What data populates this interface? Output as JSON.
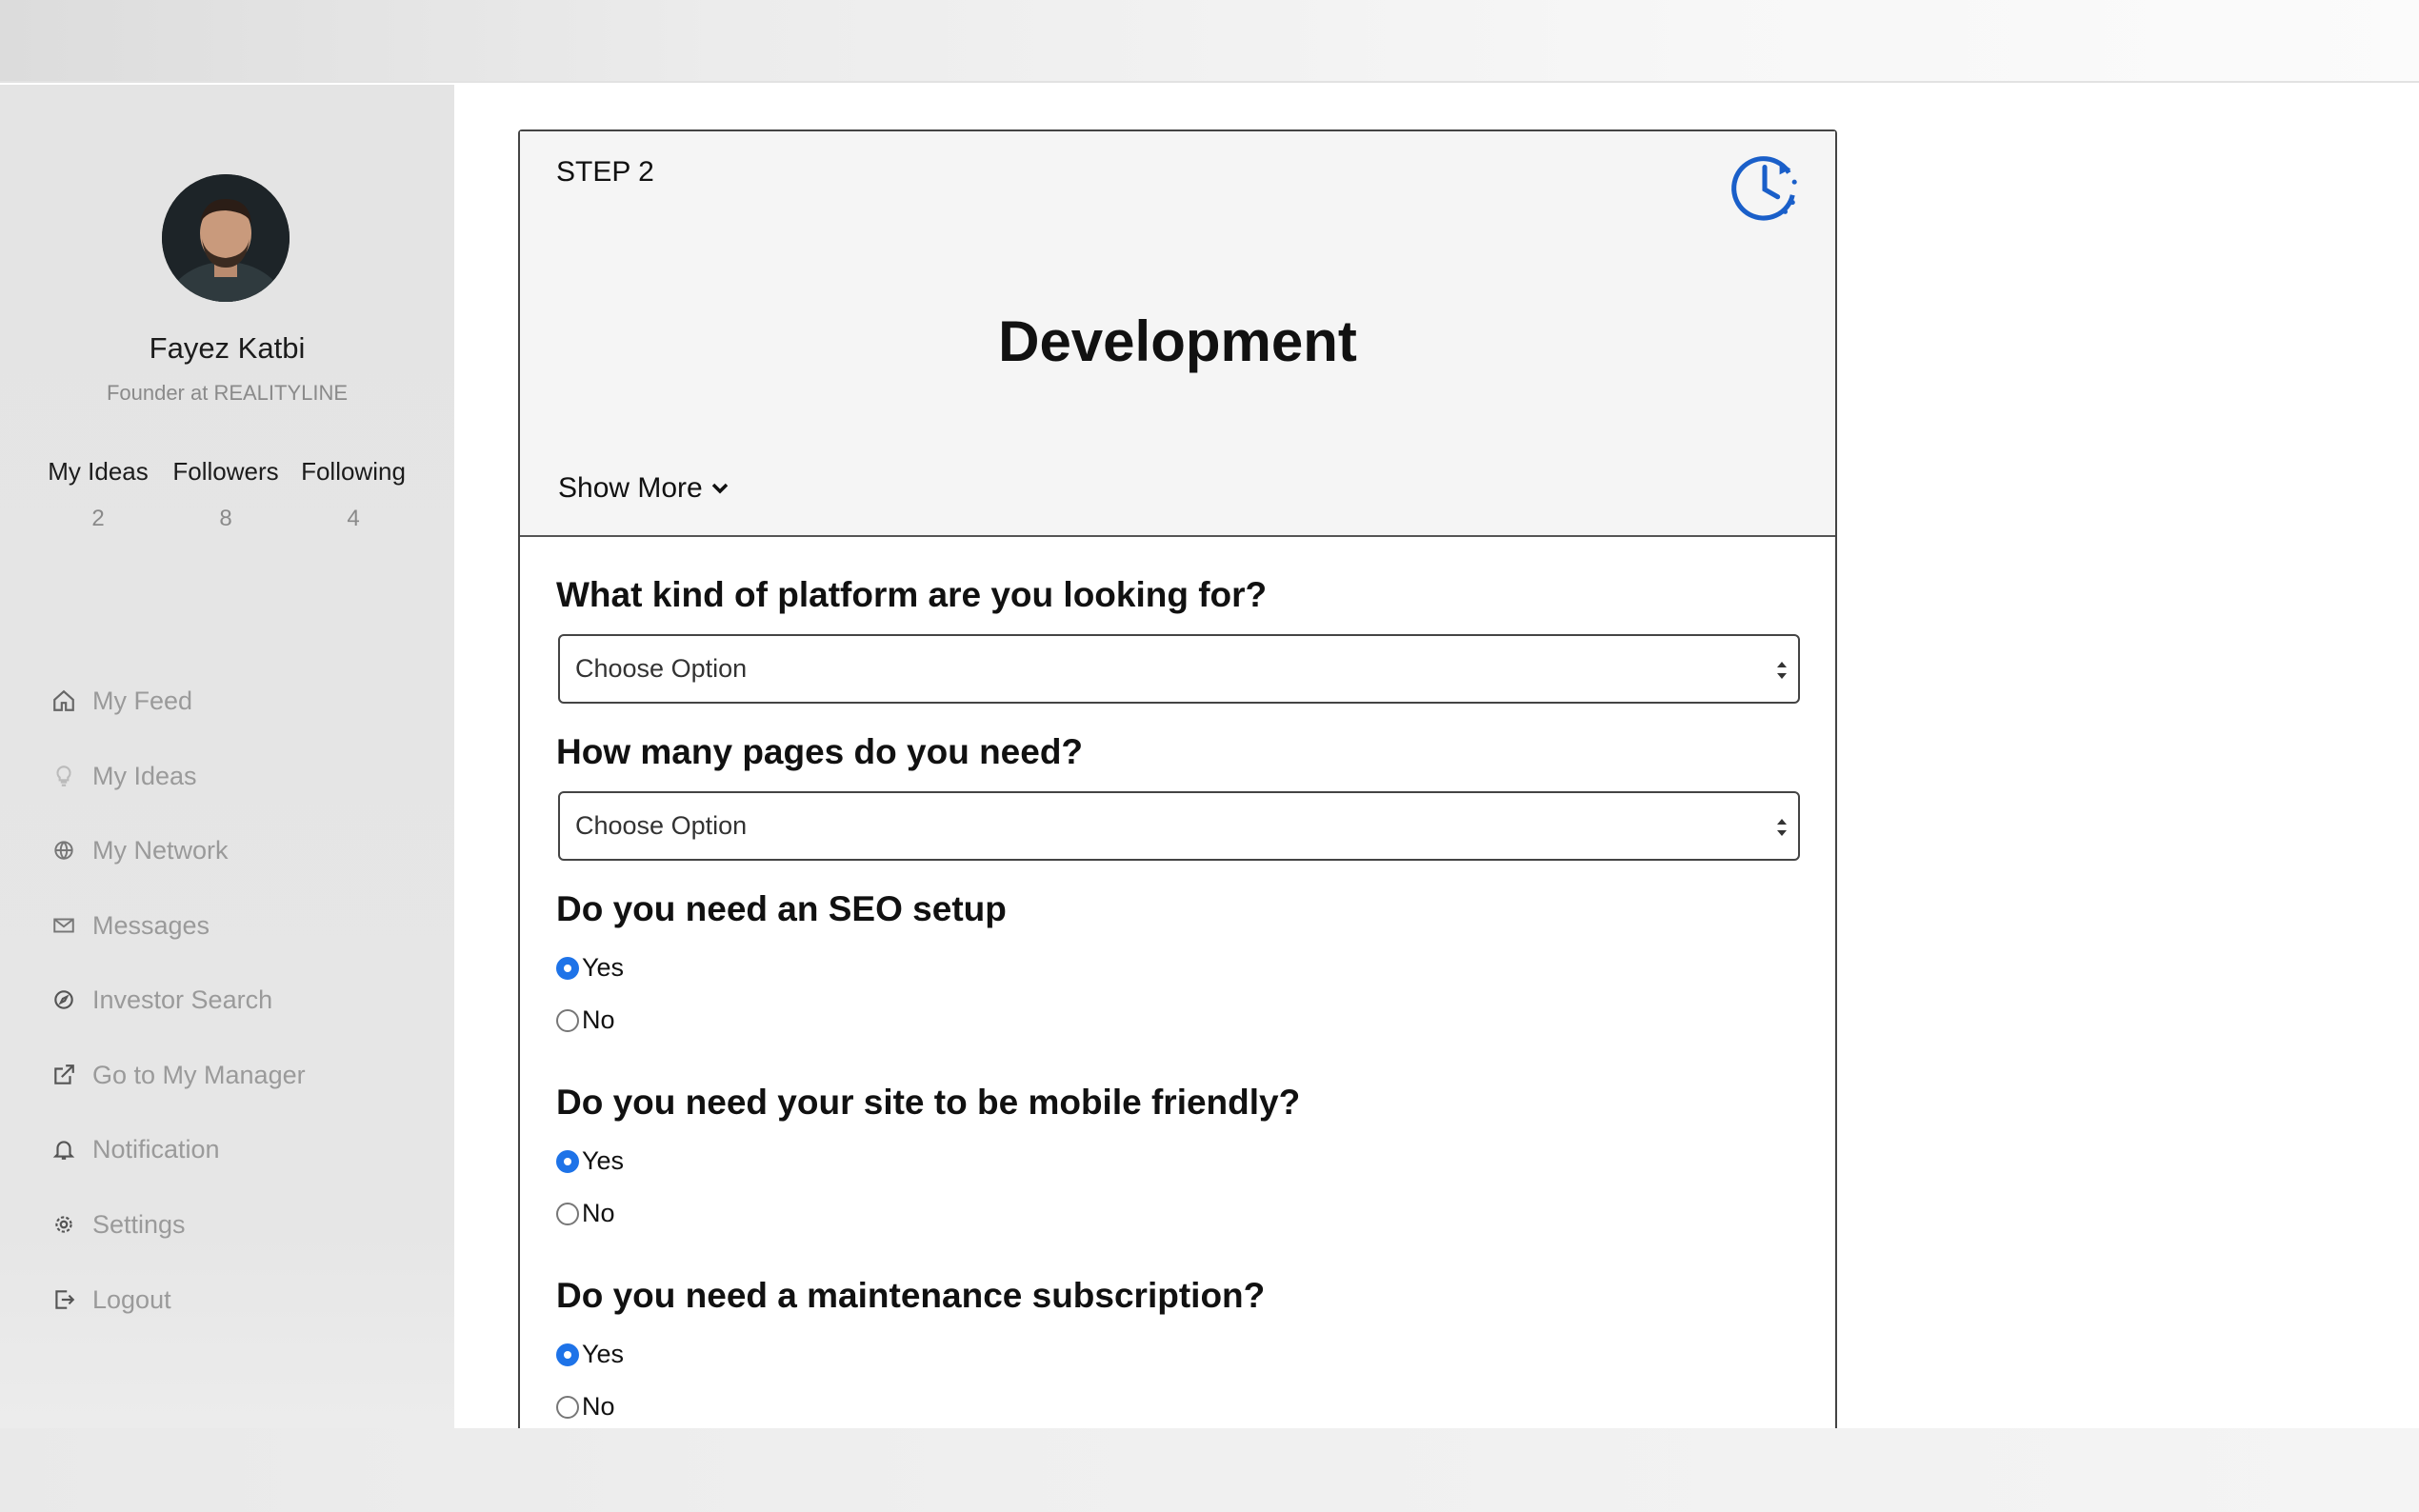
{
  "user": {
    "name": "Fayez Katbi",
    "title": "Founder at REALITYLINE"
  },
  "stats": [
    {
      "label": "My Ideas",
      "value": "2"
    },
    {
      "label": "Followers",
      "value": "8"
    },
    {
      "label": "Following",
      "value": "4"
    }
  ],
  "sidebar": {
    "items": [
      {
        "label": "My Feed",
        "icon": "home-icon"
      },
      {
        "label": "My Ideas",
        "icon": "lightbulb-icon"
      },
      {
        "label": "My Network",
        "icon": "globe-icon"
      },
      {
        "label": "Messages",
        "icon": "envelope-icon"
      },
      {
        "label": "Investor Search",
        "icon": "compass-icon"
      },
      {
        "label": "Go to My Manager",
        "icon": "external-link-icon"
      },
      {
        "label": "Notification",
        "icon": "bell-icon"
      },
      {
        "label": "Settings",
        "icon": "gear-icon"
      },
      {
        "label": "Logout",
        "icon": "logout-icon"
      }
    ]
  },
  "step": {
    "label": "STEP 2",
    "title": "Development",
    "show_more": "Show More"
  },
  "questions": {
    "platform": {
      "text": "What kind of platform are you looking for?",
      "placeholder": "Choose Option"
    },
    "pages": {
      "text": "How many pages do you need?",
      "placeholder": "Choose Option"
    },
    "seo": {
      "text": "Do you need an SEO setup",
      "yes": "Yes",
      "no": "No",
      "selected": "Yes"
    },
    "mobile": {
      "text": "Do you need your site to be mobile friendly?",
      "yes": "Yes",
      "no": "No",
      "selected": "Yes"
    },
    "maintenance": {
      "text": "Do you need a maintenance subscription?",
      "yes": "Yes",
      "no": "No",
      "selected": "Yes"
    }
  },
  "colors": {
    "accent": "#1e73e8",
    "sidebar_bg": "#e4e4e4",
    "header_bg": "#f5f5f5"
  }
}
